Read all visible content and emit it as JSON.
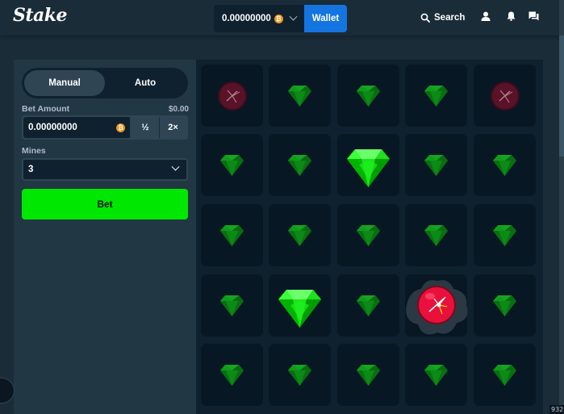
{
  "header": {
    "logo": "Stake",
    "balance": "0.00000000",
    "currency_icon": "bitcoin-icon",
    "wallet_label": "Wallet",
    "search_label": "Search",
    "icons": [
      "user-icon",
      "bell-icon",
      "chat-icon"
    ]
  },
  "sidebar": {
    "mode_tabs": [
      {
        "label": "Manual",
        "active": true
      },
      {
        "label": "Auto",
        "active": false
      }
    ],
    "bet_amount_label": "Bet Amount",
    "bet_amount_value_usd": "$0.00",
    "bet_amount": "0.00000000",
    "half_label": "½",
    "double_label": "2×",
    "mines_label": "Mines",
    "mines_value": "3",
    "bet_button": "Bet"
  },
  "grid": {
    "rows": 5,
    "cols": 5,
    "tiles": [
      "mine-dim",
      "gem-dim",
      "gem-dim",
      "gem-dim",
      "mine-dim",
      "gem-dim",
      "gem-dim",
      "gem-revealed",
      "gem-dim",
      "gem-dim",
      "gem-dim",
      "gem-dim",
      "gem-dim",
      "gem-dim",
      "gem-dim",
      "gem-dim",
      "gem-revealed",
      "gem-dim",
      "mine-exploded",
      "gem-dim",
      "gem-dim",
      "gem-dim",
      "gem-dim",
      "gem-dim",
      "gem-dim"
    ]
  },
  "corner_tag": "932",
  "colors": {
    "background": "#1a2c38",
    "panel": "#213743",
    "game_bg": "#0f212e",
    "tile": "#071824",
    "bet_button": "#00e701",
    "wallet": "#1475e1",
    "gem": "#00e701",
    "mine": "#e9113c"
  }
}
